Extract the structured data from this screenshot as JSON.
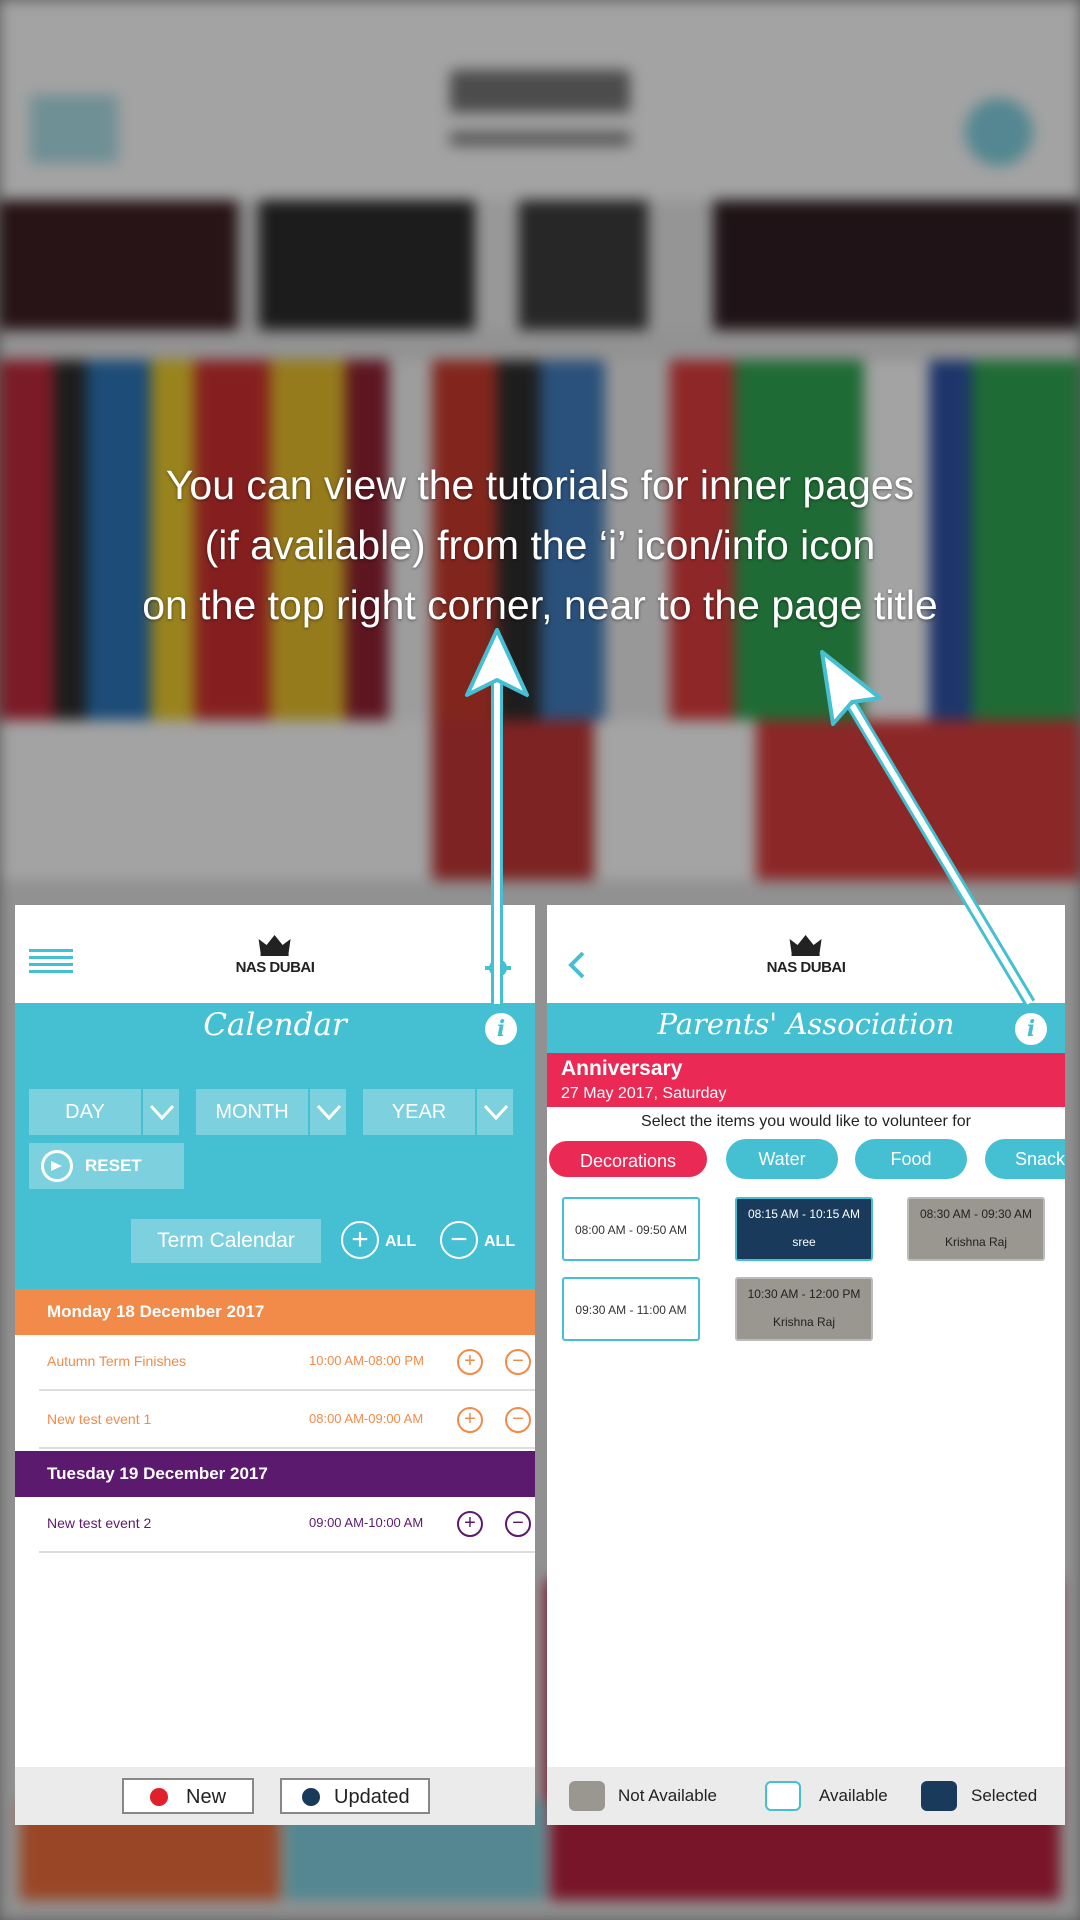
{
  "headline": {
    "lines": [
      "You can view the tutorials for inner pages",
      "(if available) from the ‘i’ icon/info icon",
      "on the top right corner, near to the page title"
    ]
  },
  "calendar_screen": {
    "logo_text": "NAS DUBAI",
    "title": "Calendar",
    "info_icon": "i",
    "filters": {
      "day": "DAY",
      "month": "MONTH",
      "year": "YEAR"
    },
    "reset_label": "RESET",
    "term_calendar_label": "Term Calendar",
    "expand_all_label": "ALL",
    "collapse_all_label": "ALL",
    "days": [
      {
        "heading": "Monday 18 December 2017",
        "color": "#f28a4a",
        "events": [
          {
            "name": "Autumn Term Finishes",
            "time": "10:00 AM-08:00 PM",
            "color": "#f28a4a"
          },
          {
            "name": "New test event 1",
            "time": "08:00 AM-09:00 AM",
            "color": "#f28a4a"
          }
        ]
      },
      {
        "heading": "Tuesday 19 December 2017",
        "color": "#5c1a6e",
        "events": [
          {
            "name": "New test event 2",
            "time": "09:00 AM-10:00 AM",
            "color": "#5c1a6e"
          }
        ]
      }
    ],
    "legend": {
      "new_label": "New",
      "new_color": "#e0202a",
      "updated_label": "Updated",
      "updated_color": "#1a3a5c"
    }
  },
  "pa_screen": {
    "logo_text": "NAS DUBAI",
    "title": "Parents' Association",
    "info_icon": "i",
    "event_title": "Anniversary",
    "event_date": "27 May 2017, Saturday",
    "instruction": "Select the items you would like to volunteer for",
    "categories": [
      "Decorations",
      "Water",
      "Food",
      "Snack"
    ],
    "slots": [
      {
        "time": "08:00 AM - 09:50 AM",
        "name": "",
        "state": "available"
      },
      {
        "time": "08:15 AM - 10:15 AM",
        "name": "sree",
        "state": "selected"
      },
      {
        "time": "08:30 AM - 09:30 AM",
        "name": "Krishna Raj",
        "state": "not-available"
      },
      {
        "time": "09:30 AM - 11:00 AM",
        "name": "",
        "state": "available"
      },
      {
        "time": "10:30 AM - 12:00 PM",
        "name": "Krishna Raj",
        "state": "not-available"
      }
    ],
    "legend": {
      "not_available": "Not Available",
      "available": "Available",
      "selected": "Selected"
    }
  },
  "colors": {
    "accent": "#45bfd2",
    "anniversary": "#ea2a55",
    "active_category": "#ea2a55",
    "selected_slot": "#1a3a5c",
    "not_available_slot": "#9a9791"
  }
}
